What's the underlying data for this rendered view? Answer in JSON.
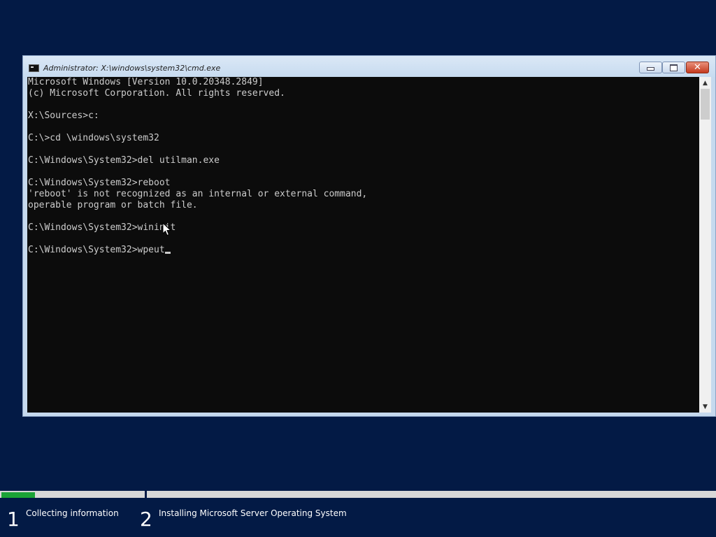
{
  "window": {
    "title": "Administrator: X:\\windows\\system32\\cmd.exe",
    "buttons": {
      "minimize": "minimize-icon",
      "maximize": "maximize-icon",
      "close": "close-icon",
      "close_glyph": "✕"
    }
  },
  "console": {
    "lines": [
      "Microsoft Windows [Version 10.0.20348.2849]",
      "(c) Microsoft Corporation. All rights reserved.",
      "",
      "X:\\Sources>c:",
      "",
      "C:\\>cd \\windows\\system32",
      "",
      "C:\\Windows\\System32>del utilman.exe",
      "",
      "C:\\Windows\\System32>reboot",
      "'reboot' is not recognized as an internal or external command,",
      "operable program or batch file.",
      "",
      "C:\\Windows\\System32>wininit",
      "",
      "C:\\Windows\\System32>wpeut"
    ],
    "text_color": "#cccccc",
    "background": "#0c0c0c"
  },
  "scrollbar": {
    "up_arrow": "▲",
    "down_arrow": "▼"
  },
  "setup": {
    "progress_fraction_step1": 0.23,
    "accent": "#1ba337",
    "steps": [
      {
        "number": "1",
        "label": "Collecting information"
      },
      {
        "number": "2",
        "label": "Installing Microsoft Server Operating System"
      }
    ]
  },
  "colors": {
    "desktop_background": "#031a45"
  }
}
